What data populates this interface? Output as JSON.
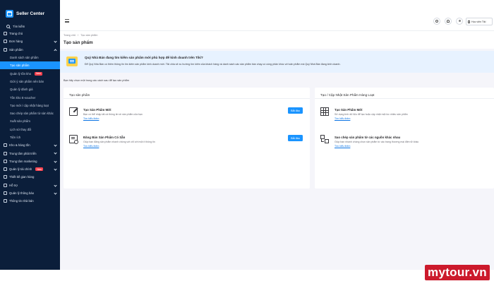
{
  "app": {
    "title": "Seller Center"
  },
  "sidebar": {
    "search_label": "Tìm kiếm",
    "items": [
      {
        "label": "Trang chủ"
      },
      {
        "label": "Đơn hàng"
      },
      {
        "label": "Sản phẩm"
      },
      {
        "label": "Danh sách sản phẩm"
      },
      {
        "label": "Tạo sản phẩm"
      },
      {
        "label": "Quản lý tồn kho",
        "badge": "New"
      },
      {
        "label": "Giới ý sản phẩm nên bán"
      },
      {
        "label": "Quản lý đánh giá"
      },
      {
        "label": "Tồn kho E-voucher"
      },
      {
        "label": "Tạo mới / cập nhật hàng loạt"
      },
      {
        "label": "Sao chép sản phẩm từ sàn khác"
      },
      {
        "label": "Xuất sản phẩm"
      },
      {
        "label": "Lịch sử thay đổi"
      },
      {
        "label": "Tiện ích"
      },
      {
        "label": "Kho & hàng tồn"
      },
      {
        "label": "Trung tâm phát triển"
      },
      {
        "label": "Trung tâm marketing"
      },
      {
        "label": "Quản lý tài chính",
        "badge": "New"
      },
      {
        "label": "Thiết kế gian hàng"
      },
      {
        "label": "Hỗ trợ"
      },
      {
        "label": "Quản lý thông báo"
      },
      {
        "label": "Thông tin nhà bán"
      }
    ]
  },
  "topbar": {
    "learn_label": "Học viện Tiki"
  },
  "breadcrumb": {
    "home": "Trang chủ",
    "sep": "/",
    "current": "Tạo sản phẩm"
  },
  "page_title": "Tạo sản phẩm",
  "notice": {
    "title": "Quý Nhà Bán đang tìm kiếm sản phẩm mới phù hợp để kinh doanh trên Tiki?",
    "text": "Để Quý Nhà Bán có thêm thông tin tìm kiếm sản phẩm kinh doanh mới. Tiki chia sẻ xu hướng tìm kiếm của khách hàng và danh sách các sản phẩm bán chạy có cùng phân khúc với sản phẩm mà Quý Nhà Bán đang kinh doanh."
  },
  "hint": "Bạn hãy chọn một trong các cách sau để tạo sản phẩm",
  "card_single": {
    "title": "Tạo sản phẩm",
    "options": [
      {
        "title": "Tạo Sản Phẩm Mới",
        "desc": "Bạn có thể nhập tất cả thông tin về sản phẩm của bạn",
        "link": "Tìm hiểu thêm",
        "button": "Bắt đầu",
        "icon": "edit-icon"
      },
      {
        "title": "Đăng Bán Sản Phẩm Có Sẵn",
        "desc": "Giúp bạn đăng sản phẩm nhanh chóng với chỉ với một ít thông tin",
        "link": "Tìm hiểu thêm",
        "button": "Bắt đầu",
        "icon": "search-document-icon"
      }
    ]
  },
  "card_bulk": {
    "title": "Tạo / Cập Nhật Sản Phẩm Hàng Loạt",
    "options": [
      {
        "title": "Tạo Sản Phẩm Mới",
        "desc": "Sử dụng tính dữ liệu để tạo hoặc cập nhật một lúc nhiều sản phẩm",
        "link": "Tìm hiểu thêm",
        "icon": "table-icon"
      },
      {
        "title": "Sao chép sản phẩm từ các nguồn khác nhau",
        "desc": "Giúp bạn nhanh chóng chọn sản phẩm từ các trang thương mại điện tử khác",
        "link": "Tìm hiểu thêm",
        "icon": "copy-icon"
      }
    ]
  },
  "watermark": "mytour.vn",
  "colors": {
    "sidebar_bg": "#0b1e3a",
    "accent": "#1a94ff",
    "notice_bg": "#e7f2ff",
    "page_bg": "#f5f5fa",
    "badge": "#ff424e"
  }
}
